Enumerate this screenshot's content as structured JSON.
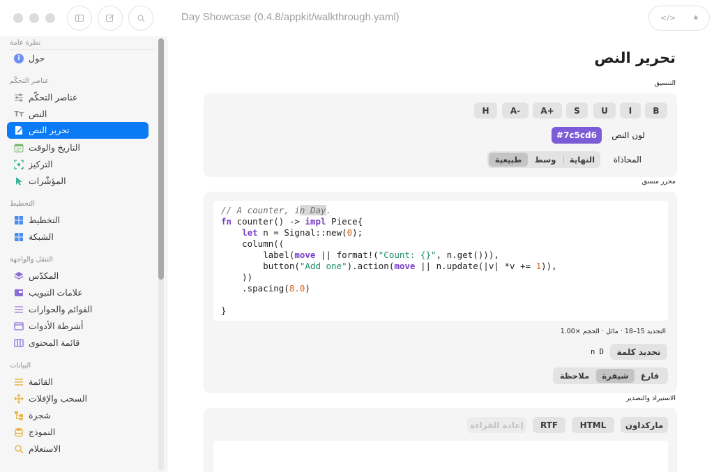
{
  "window": {
    "title": "Day Showcase (0.4.8/appkit/walkthrough.yaml)",
    "toolbar_icons": [
      "sidebar-icon",
      "compose-icon",
      "search-icon",
      "code-icon",
      "star-icon"
    ]
  },
  "sidebar": {
    "sections": [
      {
        "title": "نظرة عامة",
        "items": [
          {
            "label": "حول",
            "icon": "info-icon"
          }
        ]
      },
      {
        "title": "عناصر التحكّم",
        "items": [
          {
            "label": "عناصر التحكّم",
            "icon": "sliders-icon"
          },
          {
            "label": "النص",
            "icon": "text-icon"
          },
          {
            "label": "تحرير النص",
            "icon": "edit-text-icon",
            "active": true
          },
          {
            "label": "التاريخ والوقت",
            "icon": "calendar-icon"
          },
          {
            "label": "التركيز",
            "icon": "focus-icon"
          },
          {
            "label": "المؤشّرات",
            "icon": "cursor-icon"
          }
        ]
      },
      {
        "title": "التخطيط",
        "items": [
          {
            "label": "التخطيط",
            "icon": "layout-icon"
          },
          {
            "label": "الشبكة",
            "icon": "grid-icon"
          }
        ]
      },
      {
        "title": "التنقل والواجهة",
        "items": [
          {
            "label": "المكدّس",
            "icon": "stack-icon"
          },
          {
            "label": "علامات التبويب",
            "icon": "tabs-icon"
          },
          {
            "label": "القوائم والحوارات",
            "icon": "menu-icon"
          },
          {
            "label": "أشرطة الأدوات",
            "icon": "toolbar-icon"
          },
          {
            "label": "قائمة المحتوى",
            "icon": "columns-icon"
          }
        ]
      },
      {
        "title": "البيانات",
        "items": [
          {
            "label": "القائمة",
            "icon": "list-icon"
          },
          {
            "label": "السحب والإفلات",
            "icon": "move-icon"
          },
          {
            "label": "شجرة",
            "icon": "tree-icon"
          },
          {
            "label": "النموذج",
            "icon": "database-icon"
          },
          {
            "label": "الاستعلام",
            "icon": "query-icon"
          }
        ]
      }
    ]
  },
  "main": {
    "title": "تحرير النص",
    "formatting": {
      "caption": "التنسيق",
      "buttons": [
        "H",
        "A-",
        "A+",
        "S",
        "U",
        "I",
        "B"
      ],
      "text_color_label": "لون النص",
      "text_color_value": "#7c5cd6",
      "alignment_label": "المحاذاة",
      "alignment_options": [
        "النهاية",
        "وسط",
        "طبيعية"
      ],
      "alignment_selected": "طبيعية"
    },
    "editor": {
      "caption": "محرر منسق",
      "status": "التحديد 15–18 · مائل · الحجم ×1.00",
      "select_word_button": "تحديد كلمة",
      "selection_indicator": "n D",
      "mode_options": [
        "فارغ",
        "شيفرة",
        "ملاحظة"
      ],
      "mode_selected": "شيفرة"
    },
    "import_export": {
      "caption": "الاستيراد والتصدير",
      "buttons": [
        "ماركداون",
        "HTML",
        "RTF"
      ],
      "reload_button": "إعادة القراءة"
    }
  }
}
